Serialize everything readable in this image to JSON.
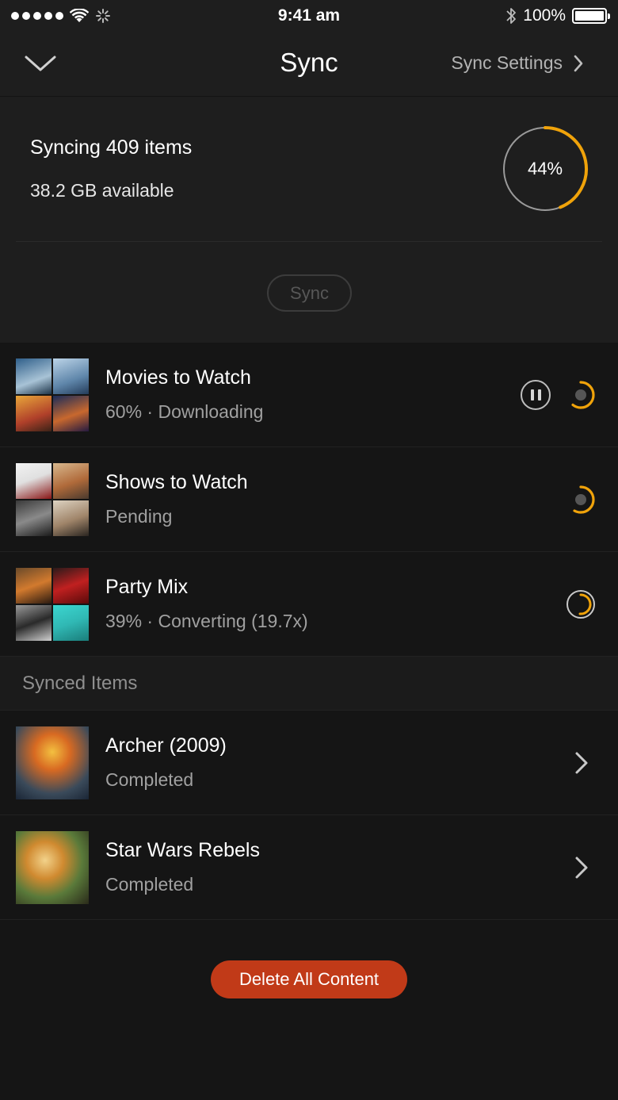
{
  "status_bar": {
    "time": "9:41 am",
    "battery": "100%"
  },
  "nav": {
    "title": "Sync",
    "settings_label": "Sync Settings"
  },
  "summary": {
    "syncing_label": "Syncing 409 items",
    "available_label": "38.2 GB available",
    "progress_label": "44%",
    "progress_fraction": 0.44,
    "sync_button": "Sync"
  },
  "colors": {
    "accent": "#f0a30a",
    "delete": "#c13a18",
    "background": "#151515",
    "panel": "#1e1e1e"
  },
  "syncing_items": [
    {
      "title": "Movies to Watch",
      "status": "60% · Downloading",
      "thumbnail": [
        "Into the Storm",
        "Frozen",
        "The Book of Life",
        "Guardians of the Galaxy"
      ],
      "has_pause": true,
      "indicator": "downloading"
    },
    {
      "title": "Shows to Watch",
      "status": "Pending",
      "thumbnail": [
        "The Blacklist",
        "Modern Family",
        "Game of Thrones",
        "House of Cards"
      ],
      "has_pause": false,
      "indicator": "pending"
    },
    {
      "title": "Party Mix",
      "status": "39% · Converting (19.7x)",
      "thumbnail": [
        "album-1",
        "album-2",
        "album-3",
        "Ministry of Sound"
      ],
      "has_pause": false,
      "indicator": "converting"
    }
  ],
  "synced_section": {
    "header": "Synced Items"
  },
  "synced_items": [
    {
      "title": "Archer (2009)",
      "status": "Completed",
      "thumbnail": "Archer"
    },
    {
      "title": "Star Wars Rebels",
      "status": "Completed",
      "thumbnail": "Star Wars Rebels"
    }
  ],
  "delete_button": "Delete All Content"
}
